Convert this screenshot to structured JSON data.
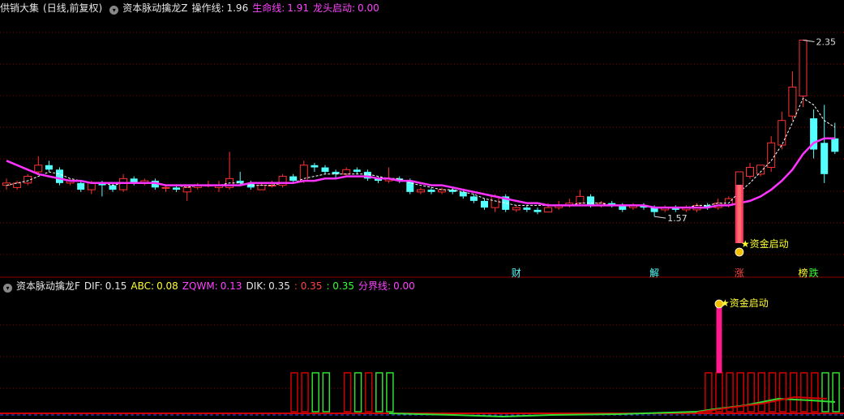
{
  "header1": {
    "name": "供销大集",
    "period": "(日线,前复权)",
    "indicator": "资本脉动擒龙Z",
    "op_label": "操作线:",
    "op_value": "1.96",
    "life_label": "生命线:",
    "life_value": "1.91",
    "dragon_label": "龙头启动:",
    "dragon_value": "0.00"
  },
  "header2": {
    "indicator": "资本脉动擒龙F",
    "dif_label": "DIF:",
    "dif_value": "0.15",
    "abc_label": "ABC:",
    "abc_value": "0.08",
    "zqwm_label": "ZQWM:",
    "zqwm_value": "0.13",
    "dik_label": "DIK:",
    "dik_value": "0.35",
    "red_value": ": 0.35",
    "green_value": ": 0.35",
    "border_label": "分界线:",
    "border_value": "0.00"
  },
  "colors": {
    "up": "#ff3333",
    "down": "#54ffff",
    "life_line": "#ff33ff",
    "op_line": "#ffffff",
    "grid": "#8b0000",
    "signal": "#ff3366",
    "hist_red": "#d00000",
    "hist_green": "#33dd33"
  },
  "chart_data": [
    {
      "type": "candlestick",
      "price_range": [
        1.35,
        2.45
      ],
      "max_label": "2.35",
      "min_label": "1.57",
      "candles": [
        [
          1.7,
          1.71,
          1.68,
          1.73
        ],
        [
          1.69,
          1.71,
          1.68,
          1.72
        ],
        [
          1.71,
          1.74,
          1.7,
          1.75
        ],
        [
          1.76,
          1.79,
          1.75,
          1.83
        ],
        [
          1.79,
          1.77,
          1.76,
          1.81
        ],
        [
          1.77,
          1.71,
          1.7,
          1.78
        ],
        [
          1.71,
          1.72,
          1.7,
          1.73
        ],
        [
          1.71,
          1.68,
          1.67,
          1.72
        ],
        [
          1.68,
          1.71,
          1.66,
          1.72
        ],
        [
          1.71,
          1.7,
          1.65,
          1.72
        ],
        [
          1.7,
          1.68,
          1.67,
          1.71
        ],
        [
          1.68,
          1.73,
          1.67,
          1.75
        ],
        [
          1.73,
          1.71,
          1.7,
          1.74
        ],
        [
          1.71,
          1.72,
          1.7,
          1.73
        ],
        [
          1.72,
          1.69,
          1.68,
          1.73
        ],
        [
          1.69,
          1.69,
          1.67,
          1.7
        ],
        [
          1.69,
          1.68,
          1.67,
          1.7
        ],
        [
          1.67,
          1.69,
          1.63,
          1.7
        ],
        [
          1.69,
          1.7,
          1.68,
          1.71
        ],
        [
          1.7,
          1.7,
          1.69,
          1.72
        ],
        [
          1.69,
          1.7,
          1.67,
          1.72
        ],
        [
          1.69,
          1.73,
          1.68,
          1.85
        ],
        [
          1.72,
          1.71,
          1.7,
          1.76
        ],
        [
          1.71,
          1.69,
          1.68,
          1.72
        ],
        [
          1.68,
          1.7,
          1.68,
          1.71
        ],
        [
          1.7,
          1.7,
          1.69,
          1.72
        ],
        [
          1.7,
          1.74,
          1.69,
          1.75
        ],
        [
          1.74,
          1.72,
          1.71,
          1.75
        ],
        [
          1.72,
          1.79,
          1.71,
          1.81
        ],
        [
          1.79,
          1.78,
          1.76,
          1.8
        ],
        [
          1.78,
          1.76,
          1.75,
          1.79
        ],
        [
          1.76,
          1.75,
          1.73,
          1.77
        ],
        [
          1.75,
          1.77,
          1.74,
          1.78
        ],
        [
          1.77,
          1.76,
          1.75,
          1.78
        ],
        [
          1.76,
          1.73,
          1.72,
          1.77
        ],
        [
          1.73,
          1.72,
          1.71,
          1.74
        ],
        [
          1.72,
          1.73,
          1.71,
          1.78
        ],
        [
          1.73,
          1.72,
          1.71,
          1.74
        ],
        [
          1.72,
          1.67,
          1.66,
          1.73
        ],
        [
          1.67,
          1.68,
          1.66,
          1.69
        ],
        [
          1.68,
          1.67,
          1.66,
          1.69
        ],
        [
          1.67,
          1.68,
          1.66,
          1.69
        ],
        [
          1.68,
          1.67,
          1.66,
          1.69
        ],
        [
          1.67,
          1.65,
          1.64,
          1.68
        ],
        [
          1.65,
          1.63,
          1.62,
          1.66
        ],
        [
          1.63,
          1.6,
          1.59,
          1.64
        ],
        [
          1.6,
          1.65,
          1.58,
          1.66
        ],
        [
          1.65,
          1.59,
          1.58,
          1.66
        ],
        [
          1.59,
          1.6,
          1.58,
          1.61
        ],
        [
          1.6,
          1.59,
          1.58,
          1.61
        ],
        [
          1.59,
          1.58,
          1.57,
          1.6
        ],
        [
          1.58,
          1.6,
          1.58,
          1.62
        ],
        [
          1.6,
          1.61,
          1.59,
          1.63
        ],
        [
          1.61,
          1.62,
          1.6,
          1.64
        ],
        [
          1.62,
          1.65,
          1.61,
          1.68
        ],
        [
          1.65,
          1.61,
          1.6,
          1.66
        ],
        [
          1.61,
          1.62,
          1.6,
          1.63
        ],
        [
          1.62,
          1.61,
          1.6,
          1.63
        ],
        [
          1.61,
          1.59,
          1.58,
          1.62
        ],
        [
          1.6,
          1.61,
          1.59,
          1.62
        ],
        [
          1.61,
          1.6,
          1.59,
          1.62
        ],
        [
          1.6,
          1.58,
          1.56,
          1.61
        ],
        [
          1.59,
          1.6,
          1.58,
          1.61
        ],
        [
          1.6,
          1.59,
          1.58,
          1.61
        ],
        [
          1.59,
          1.6,
          1.58,
          1.61
        ],
        [
          1.59,
          1.61,
          1.58,
          1.62
        ],
        [
          1.61,
          1.6,
          1.59,
          1.62
        ],
        [
          1.6,
          1.62,
          1.59,
          1.64
        ],
        [
          1.61,
          1.64,
          1.6,
          1.65
        ],
        [
          1.62,
          1.76,
          1.62,
          1.76
        ],
        [
          1.74,
          1.78,
          1.73,
          1.8
        ],
        [
          1.75,
          1.79,
          1.74,
          1.79
        ],
        [
          1.78,
          1.89,
          1.76,
          1.92
        ],
        [
          1.88,
          1.99,
          1.86,
          2.03
        ],
        [
          2.01,
          2.14,
          1.99,
          2.21
        ],
        [
          2.1,
          2.35,
          2.05,
          2.35
        ],
        [
          2.0,
          1.86,
          1.82,
          2.04
        ],
        [
          1.89,
          1.75,
          1.71,
          2.06
        ],
        [
          1.91,
          1.85,
          1.84,
          1.98
        ]
      ],
      "life_line": [
        1.81,
        1.79,
        1.77,
        1.75,
        1.74,
        1.73,
        1.72,
        1.72,
        1.71,
        1.71,
        1.71,
        1.71,
        1.71,
        1.71,
        1.71,
        1.7,
        1.7,
        1.7,
        1.7,
        1.7,
        1.7,
        1.7,
        1.7,
        1.71,
        1.71,
        1.71,
        1.71,
        1.71,
        1.72,
        1.72,
        1.73,
        1.73,
        1.74,
        1.74,
        1.74,
        1.73,
        1.73,
        1.72,
        1.72,
        1.71,
        1.7,
        1.7,
        1.69,
        1.68,
        1.67,
        1.66,
        1.65,
        1.64,
        1.63,
        1.62,
        1.62,
        1.61,
        1.61,
        1.61,
        1.61,
        1.61,
        1.61,
        1.61,
        1.61,
        1.61,
        1.61,
        1.6,
        1.6,
        1.6,
        1.6,
        1.6,
        1.6,
        1.61,
        1.61,
        1.62,
        1.63,
        1.65,
        1.68,
        1.72,
        1.77,
        1.84,
        1.89,
        1.91,
        1.91
      ],
      "op_line": [
        1.7,
        1.71,
        1.72,
        1.74,
        1.76,
        1.75,
        1.73,
        1.72,
        1.71,
        1.71,
        1.7,
        1.71,
        1.71,
        1.71,
        1.71,
        1.7,
        1.7,
        1.69,
        1.7,
        1.7,
        1.7,
        1.71,
        1.71,
        1.7,
        1.7,
        1.7,
        1.71,
        1.71,
        1.73,
        1.74,
        1.75,
        1.75,
        1.75,
        1.75,
        1.75,
        1.74,
        1.73,
        1.73,
        1.71,
        1.7,
        1.69,
        1.68,
        1.68,
        1.67,
        1.66,
        1.64,
        1.63,
        1.62,
        1.61,
        1.61,
        1.61,
        1.61,
        1.61,
        1.61,
        1.62,
        1.62,
        1.62,
        1.61,
        1.61,
        1.61,
        1.61,
        1.6,
        1.6,
        1.6,
        1.6,
        1.61,
        1.61,
        1.62,
        1.62,
        1.67,
        1.71,
        1.76,
        1.81,
        1.88,
        1.98,
        2.09,
        2.06,
        1.99,
        1.96
      ],
      "markers": [
        {
          "index": 48,
          "text": "财",
          "color": "#54ffff"
        },
        {
          "index": 61,
          "text": "解",
          "color": "#54ffff"
        },
        {
          "index": 69,
          "text": "涨",
          "color": "#ff4444"
        },
        {
          "index": 75,
          "text": "榜",
          "color": "#ffff33"
        },
        {
          "index": 76,
          "text": "跌",
          "color": "#33ff33"
        }
      ],
      "signal_index": 69,
      "signal_label": "资金启动"
    },
    {
      "type": "bar",
      "signal_label": "资金启动",
      "red_bar_indices": [
        27,
        28,
        32,
        34,
        66,
        67,
        68,
        69,
        70,
        71,
        72,
        73,
        74,
        75,
        76
      ],
      "green_bar_indices": [
        29,
        30,
        33,
        35,
        36,
        77,
        78
      ],
      "signal_bar_index": 67
    }
  ]
}
